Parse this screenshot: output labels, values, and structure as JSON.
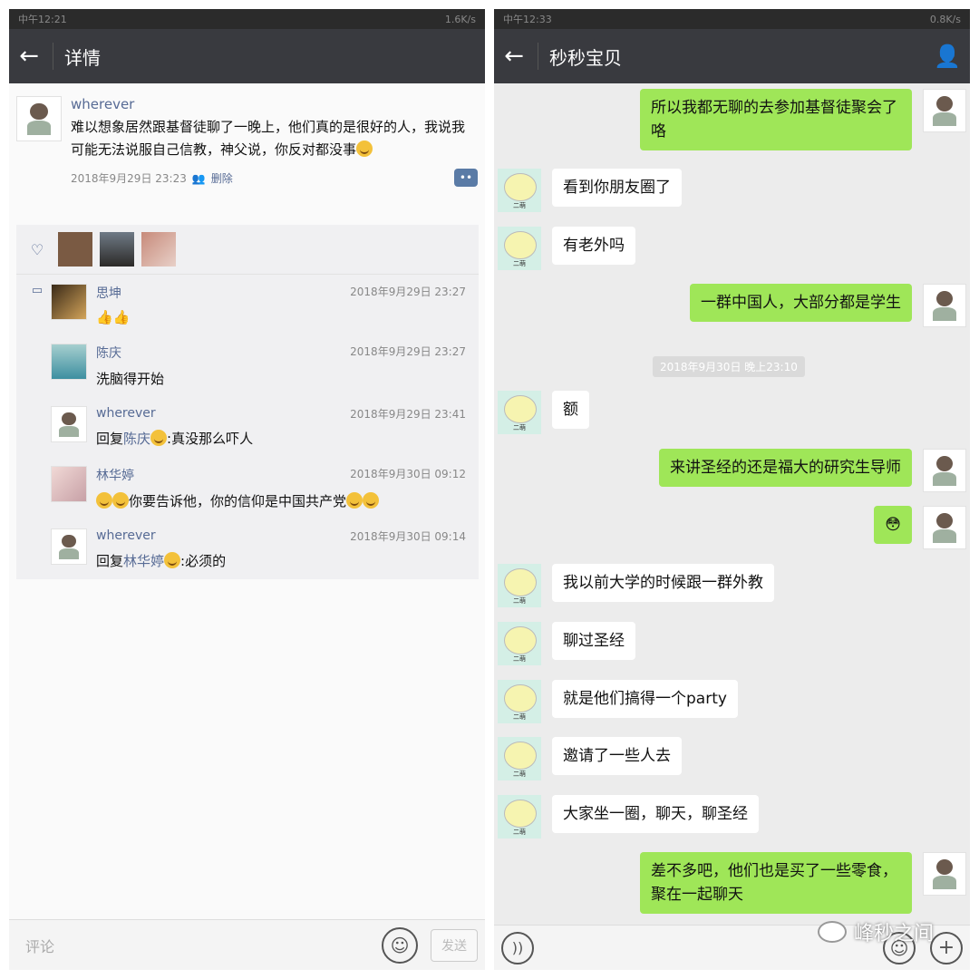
{
  "left": {
    "status": {
      "time": "中午12:21",
      "speed": "1.6K/s",
      "battery": "40"
    },
    "title": "详情",
    "post": {
      "author": "wherever",
      "text": "难以想象居然跟基督徒聊了一晚上，他们真的是很好的人，我说我可能无法说服自己信教，神父说，你反对都没事",
      "time": "2018年9月29日 23:23",
      "delete": "删除"
    },
    "comments": [
      {
        "name": "思坤",
        "time": "2018年9月29日 23:27",
        "text": "👍👍"
      },
      {
        "name": "陈庆",
        "time": "2018年9月29日 23:27",
        "text": "洗脑得开始"
      },
      {
        "name": "wherever",
        "time": "2018年9月29日 23:41",
        "prefix": "回复",
        "target": "陈庆",
        "text": ":真没那么吓人"
      },
      {
        "name": "林华婷",
        "time": "2018年9月30日 09:12",
        "text": "你要告诉他，你的信仰是中国共产党"
      },
      {
        "name": "wherever",
        "time": "2018年9月30日 09:14",
        "prefix": "回复",
        "target": "林华婷",
        "text": ":必须的"
      }
    ],
    "input_placeholder": "评论",
    "send": "发送"
  },
  "right": {
    "status": {
      "time": "中午12:33",
      "speed": "0.8K/s",
      "battery": "36"
    },
    "title": "秒秒宝贝",
    "timestamp": "2018年9月30日 晚上23:10",
    "messages": [
      {
        "side": "out",
        "text": "所以我都无聊的去参加基督徒聚会了咯"
      },
      {
        "side": "in",
        "text": "看到你朋友圈了"
      },
      {
        "side": "in",
        "text": "有老外吗"
      },
      {
        "side": "out",
        "text": "一群中国人，大部分都是学生"
      },
      {
        "side": "in",
        "text": "额"
      },
      {
        "side": "out",
        "text": "来讲圣经的还是福大的研究生导师"
      },
      {
        "side": "out",
        "text": "😳"
      },
      {
        "side": "in",
        "text": "我以前大学的时候跟一群外教"
      },
      {
        "side": "in",
        "text": "聊过圣经"
      },
      {
        "side": "in",
        "text": "就是他们搞得一个party"
      },
      {
        "side": "in",
        "text": "邀请了一些人去"
      },
      {
        "side": "in",
        "text": "大家坐一圈，聊天，聊圣经"
      },
      {
        "side": "out",
        "text": "差不多吧，他们也是买了一些零食，聚在一起聊天"
      }
    ],
    "watermark": "峰秒之间"
  }
}
